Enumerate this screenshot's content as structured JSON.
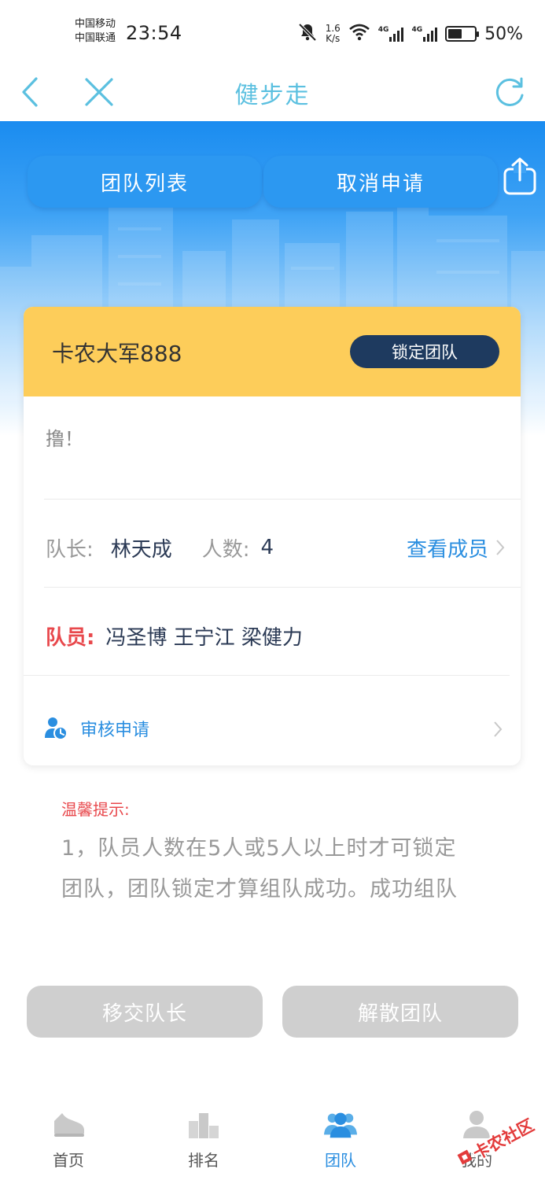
{
  "status_bar": {
    "carrier_1": "中国移动",
    "carrier_2": "中国联通",
    "time": "23:54",
    "net_speed_value": "1.6",
    "net_speed_unit": "K/s",
    "sim1_type": "4G",
    "sim2_type": "4G",
    "battery_percent": "50%",
    "icons": [
      "mute-icon",
      "wifi-icon",
      "signal-icon",
      "battery-icon"
    ]
  },
  "nav": {
    "title": "健步走",
    "icons": [
      "back-icon",
      "close-icon",
      "refresh-icon"
    ]
  },
  "hero": {
    "tabs": [
      {
        "label": "团队列表"
      },
      {
        "label": "取消申请"
      }
    ],
    "share_icon": "share-icon"
  },
  "team": {
    "name": "卡农大军888",
    "lock_label": "锁定团队",
    "slogan": "撸！",
    "leader_label": "队长:",
    "leader_name": "林天成",
    "count_label": "人数:",
    "count_value": "4",
    "view_members_label": "查看成员",
    "members_label": "队员:",
    "members": "冯圣博 王宁江 梁健力",
    "review_label": "审核申请"
  },
  "tips": {
    "title": "温馨提示:",
    "line1": "1，队员人数在5人或5人以上时才可锁定",
    "line2": "团队，团队锁定才算组队成功。成功组队"
  },
  "actions": {
    "transfer_label": "移交队长",
    "disband_label": "解散团队"
  },
  "tab_bar": {
    "items": [
      {
        "label": "首页",
        "icon": "shoe-icon"
      },
      {
        "label": "排名",
        "icon": "podium-icon"
      },
      {
        "label": "团队",
        "icon": "team-icon"
      },
      {
        "label": "我的",
        "icon": "user-icon"
      }
    ],
    "active_index": 2
  },
  "watermark": {
    "text": "卡农社区"
  },
  "colors": {
    "accent": "#2a8ee0",
    "nav_title": "#5bc0e0",
    "header_yellow": "#fdcd5a",
    "lock_button": "#1e3a5f",
    "warning_red": "#e8484c",
    "disabled_button": "#cfcfcf"
  }
}
